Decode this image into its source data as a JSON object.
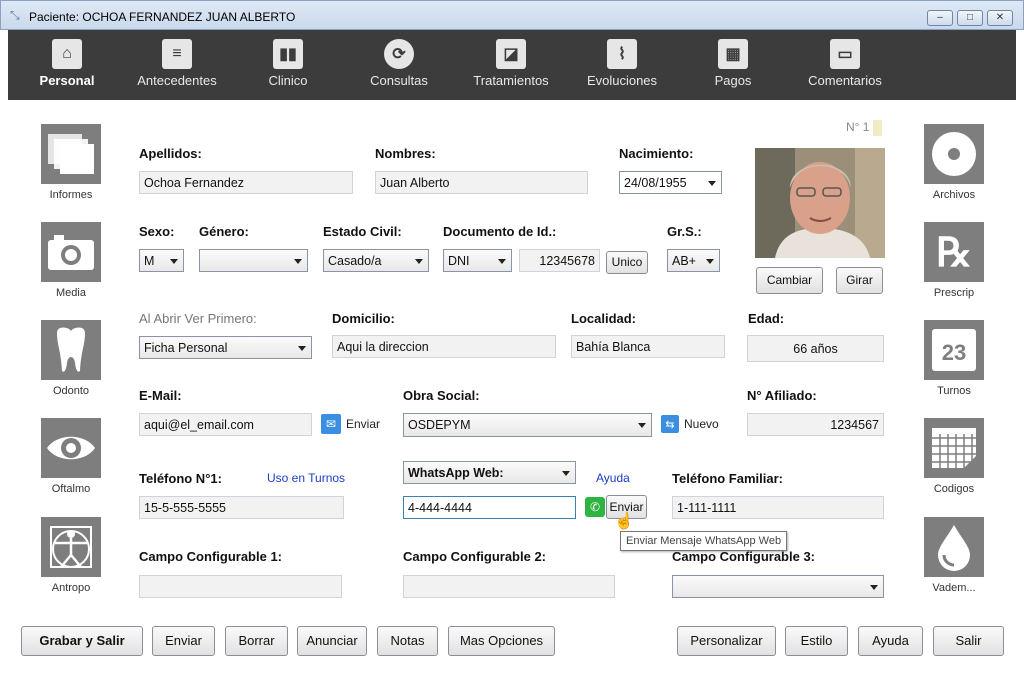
{
  "window": {
    "title": "Paciente: OCHOA FERNANDEZ JUAN ALBERTO"
  },
  "toolbar": {
    "items": [
      {
        "label": "Personal",
        "icon": "house-icon",
        "active": true
      },
      {
        "label": "Antecedentes",
        "icon": "document-icon"
      },
      {
        "label": "Clinico",
        "icon": "bar-chart-icon"
      },
      {
        "label": "Consultas",
        "icon": "refresh-icon"
      },
      {
        "label": "Tratamientos",
        "icon": "tags-icon"
      },
      {
        "label": "Evoluciones",
        "icon": "pulse-icon"
      },
      {
        "label": "Pagos",
        "icon": "calculator-icon"
      },
      {
        "label": "Comentarios",
        "icon": "speech-bubble-icon"
      }
    ]
  },
  "left_panel": [
    {
      "label": "Informes",
      "icon": "stacked-pages-icon"
    },
    {
      "label": "Media",
      "icon": "camera-icon"
    },
    {
      "label": "Odonto",
      "icon": "tooth-icon"
    },
    {
      "label": "Oftalmo",
      "icon": "eye-icon"
    },
    {
      "label": "Antropo",
      "icon": "vitruvian-man-icon"
    }
  ],
  "right_panel": [
    {
      "label": "Archivos",
      "icon": "disc-icon"
    },
    {
      "label": "Prescrip",
      "icon": "rx-icon"
    },
    {
      "label": "Turnos",
      "icon": "calendar-icon",
      "day": "23"
    },
    {
      "label": "Codigos",
      "icon": "grid-icon"
    },
    {
      "label": "Vadem...",
      "icon": "drop-icon"
    }
  ],
  "record_number": "N° 1",
  "form": {
    "apellidos": {
      "label": "Apellidos:",
      "value": "Ochoa Fernandez"
    },
    "nombres": {
      "label": "Nombres:",
      "value": "Juan Alberto"
    },
    "nacimiento": {
      "label": "Nacimiento:",
      "value": "24/08/1955"
    },
    "sexo": {
      "label": "Sexo:",
      "value": "M"
    },
    "genero": {
      "label": "Género:",
      "value": ""
    },
    "estado_civil": {
      "label": "Estado Civil:",
      "value": "Casado/a"
    },
    "documento": {
      "label": "Documento de Id.:",
      "type": "DNI",
      "number": "12345678",
      "unique_label": "Unico"
    },
    "grupo_sanguineo": {
      "label": "Gr.S.:",
      "value": "AB+"
    },
    "abrir_primero": {
      "label": "Al Abrir Ver Primero:",
      "value": "Ficha Personal"
    },
    "domicilio": {
      "label": "Domicilio:",
      "value": "Aqui la direccion"
    },
    "localidad": {
      "label": "Localidad:",
      "value": "Bahía Blanca"
    },
    "edad": {
      "label": "Edad:",
      "value": "66 años"
    },
    "email": {
      "label": "E-Mail:",
      "value": "aqui@el_email.com",
      "send_label": "Enviar"
    },
    "obra_social": {
      "label": "Obra Social:",
      "value": "OSDEPYM",
      "new_label": "Nuevo"
    },
    "afiliado": {
      "label": "N° Afiliado:",
      "value": "1234567"
    },
    "telefono1": {
      "label": "Teléfono N°1:",
      "value": "15-5-555-5555",
      "link": "Uso en Turnos"
    },
    "whatsapp": {
      "select_value": "WhatsApp Web:",
      "help_link": "Ayuda",
      "value": "4-444-4444",
      "send_label": "Enviar"
    },
    "telefono_familiar": {
      "label": "Teléfono Familiar:",
      "value": "1-111-1111"
    },
    "campo1": {
      "label": "Campo Configurable 1:",
      "value": ""
    },
    "campo2": {
      "label": "Campo Configurable 2:",
      "value": ""
    },
    "campo3": {
      "label": "Campo Configurable 3:",
      "value": ""
    }
  },
  "photo_buttons": {
    "change": "Cambiar",
    "rotate": "Girar"
  },
  "tooltip": "Enviar Mensaje WhatsApp Web",
  "bottom_buttons": {
    "save_exit": "Grabar y Salir",
    "send": "Enviar",
    "delete": "Borrar",
    "announce": "Anunciar",
    "notes": "Notas",
    "more": "Mas Opciones",
    "customize": "Personalizar",
    "style": "Estilo",
    "help": "Ayuda",
    "exit": "Salir"
  },
  "colors": {
    "toolbar_bg": "#3c3c3c",
    "side_icon_bg": "#7e7e7e",
    "whatsapp": "#2fb343",
    "mail": "#3b8fe0",
    "link": "#1a3ec8"
  }
}
